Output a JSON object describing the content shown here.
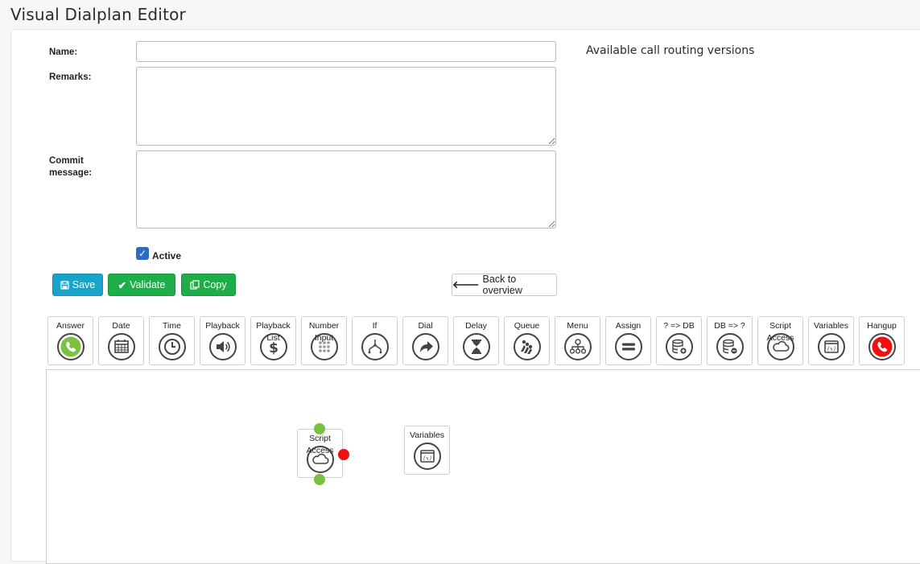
{
  "page": {
    "title": "Visual Dialplan Editor"
  },
  "form": {
    "name_label": "Name:",
    "name_value": "",
    "remarks_label": "Remarks:",
    "remarks_value": "",
    "commit_label": "Commit message:",
    "commit_value": "",
    "active_label": "Active",
    "active_checked": true
  },
  "versions": {
    "title": "Available call routing versions"
  },
  "buttons": {
    "save": "Save",
    "validate": "Validate",
    "copy": "Copy",
    "back": "Back to overview"
  },
  "palette": [
    {
      "label": "Answer",
      "icon": "phone-answer-icon"
    },
    {
      "label": "Date",
      "icon": "calendar-icon"
    },
    {
      "label": "Time",
      "icon": "clock-icon"
    },
    {
      "label": "Playback",
      "icon": "speaker-icon"
    },
    {
      "label": "Playback List",
      "icon": "dollar-icon"
    },
    {
      "label": "Number Input",
      "icon": "keypad-icon"
    },
    {
      "label": "If",
      "icon": "branch-icon"
    },
    {
      "label": "Dial",
      "icon": "forward-arrow-icon"
    },
    {
      "label": "Delay",
      "icon": "hourglass-icon"
    },
    {
      "label": "Queue",
      "icon": "queue-icon"
    },
    {
      "label": "Menu",
      "icon": "sitemap-icon"
    },
    {
      "label": "Assign",
      "icon": "equals-icon"
    },
    {
      "label": "? => DB",
      "icon": "db-write-icon"
    },
    {
      "label": "DB => ?",
      "icon": "db-read-icon"
    },
    {
      "label": "Script Access",
      "icon": "cloud-icon"
    },
    {
      "label": "Variables",
      "icon": "variables-icon"
    },
    {
      "label": "Hangup",
      "icon": "phone-hangup-icon"
    }
  ],
  "canvas": {
    "nodes": [
      {
        "label": "Script Access",
        "icon": "cloud-icon"
      },
      {
        "label": "Variables",
        "icon": "variables-icon"
      }
    ]
  },
  "colors": {
    "save": "#1aa3c8",
    "validate": "#1fad4a",
    "copy": "#1fad4a",
    "answer": "#7cc040",
    "hangup": "#f00e0e",
    "connector_in": "#7cc040",
    "connector_out": "#f00e0e"
  }
}
